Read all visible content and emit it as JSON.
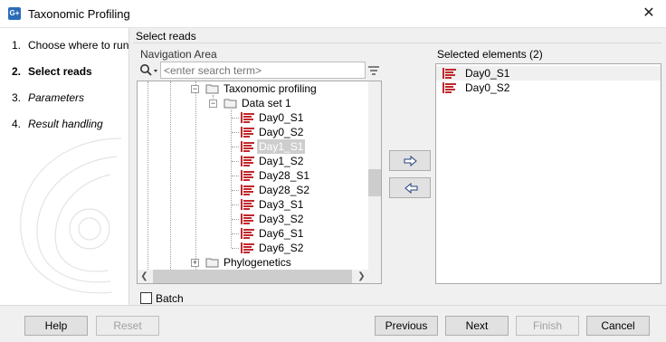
{
  "window": {
    "title": "Taxonomic Profiling",
    "app_icon_text": "G+"
  },
  "steps": [
    {
      "num": "1.",
      "label": "Choose where to run"
    },
    {
      "num": "2.",
      "label": "Select reads"
    },
    {
      "num": "3.",
      "label": "Parameters"
    },
    {
      "num": "4.",
      "label": "Result handling"
    }
  ],
  "panel": {
    "group_title": "Select reads",
    "navigation_label": "Navigation Area",
    "selected_label": "Selected elements (2)"
  },
  "search": {
    "placeholder": "<enter search term>"
  },
  "tree": {
    "parent_folder": "Taxonomic profiling",
    "subfolder": "Data set 1",
    "items": [
      "Day0_S1",
      "Day0_S2",
      "Day1_S1",
      "Day1_S2",
      "Day28_S1",
      "Day28_S2",
      "Day3_S1",
      "Day3_S2",
      "Day6_S1",
      "Day6_S2"
    ],
    "selected_item": "Day1_S1",
    "next_folder": "Phylogenetics"
  },
  "selected_elements": [
    "Day0_S1",
    "Day0_S2"
  ],
  "batch": {
    "label": "Batch",
    "checked": false
  },
  "buttons": {
    "help": "Help",
    "reset": "Reset",
    "previous": "Previous",
    "next": "Next",
    "finish": "Finish",
    "cancel": "Cancel"
  },
  "colors": {
    "seq_icon": "#c0282d",
    "folder": "#f2f2f2",
    "accent": "#2b6cb7"
  }
}
